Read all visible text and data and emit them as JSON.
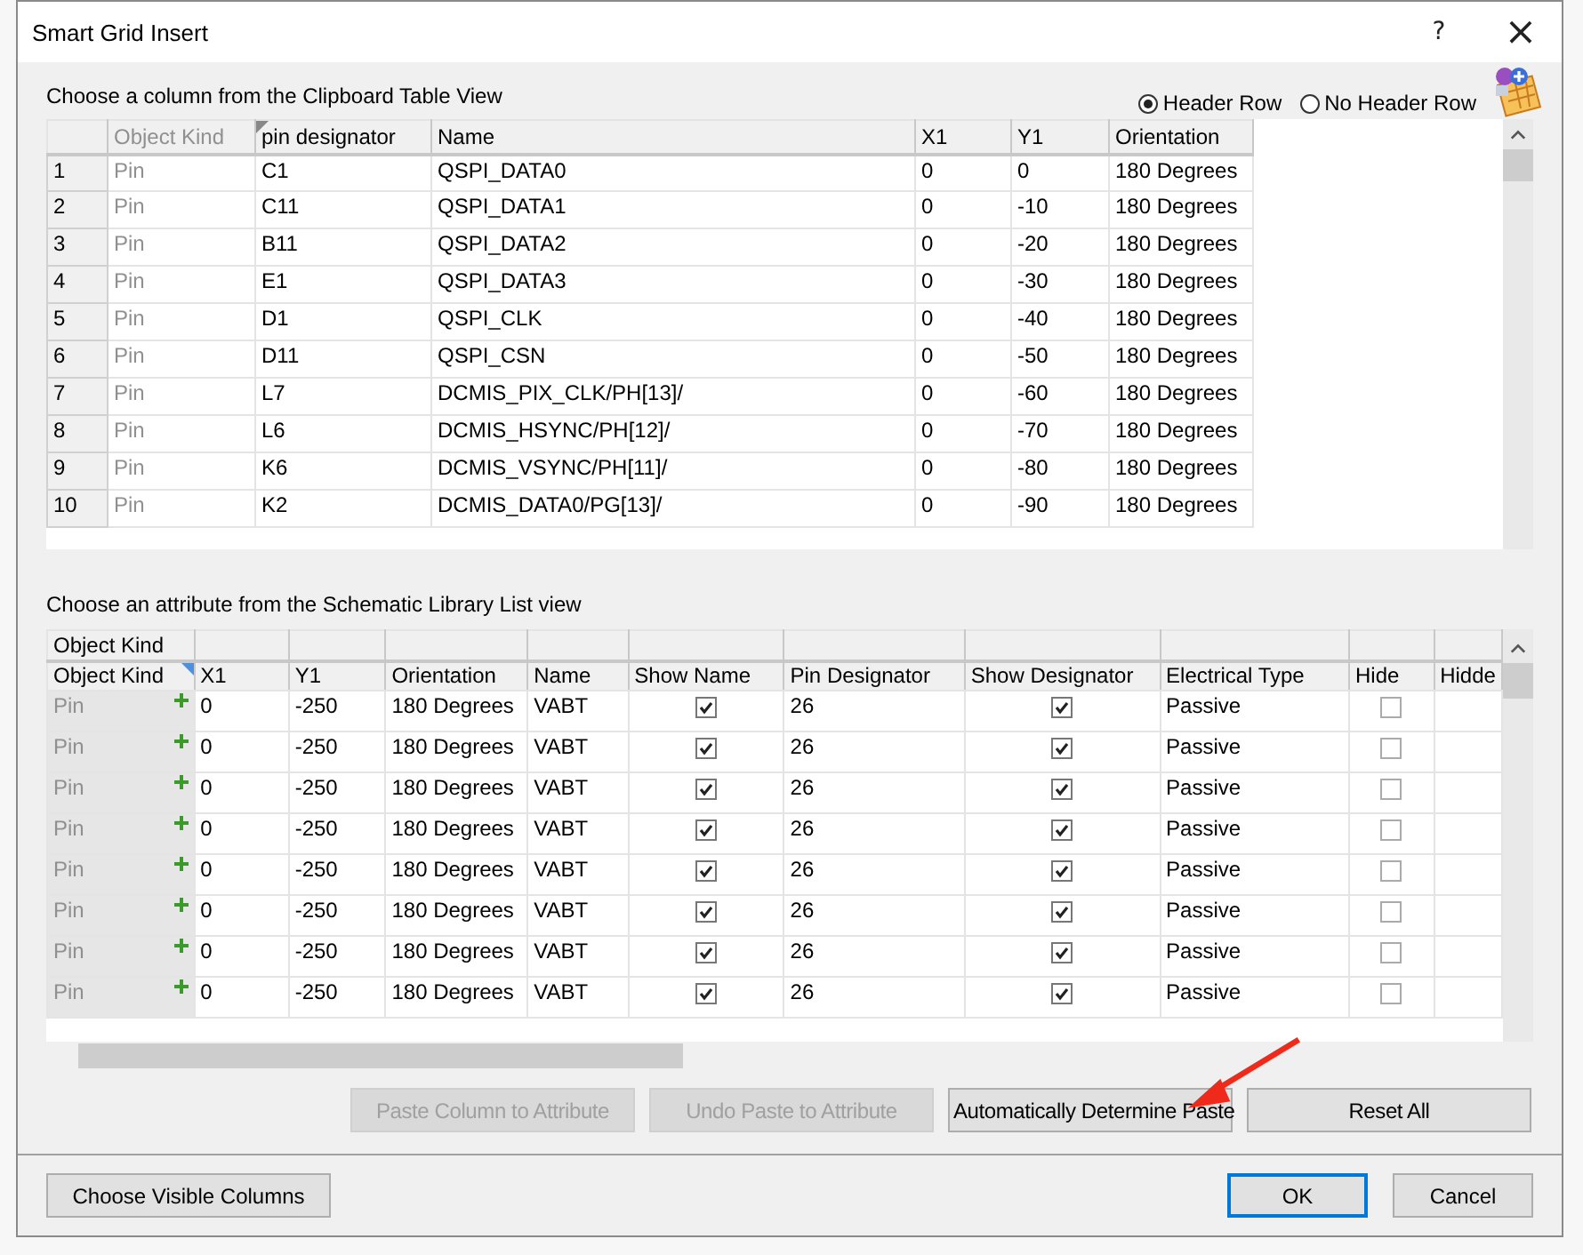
{
  "window": {
    "title": "Smart Grid Insert",
    "help": "?",
    "close": "×"
  },
  "clipboard": {
    "label": "Choose a column from the Clipboard Table View",
    "header_options": [
      {
        "label": "Header Row",
        "selected": true
      },
      {
        "label": "No Header Row",
        "selected": false
      }
    ],
    "columns": [
      "",
      "Object Kind",
      "pin designator",
      "Name",
      "X1",
      "Y1",
      "Orientation"
    ],
    "rows": [
      [
        "1",
        "Pin",
        "C1",
        "QSPI_DATA0",
        "0",
        "0",
        "180 Degrees"
      ],
      [
        "2",
        "Pin",
        "C11",
        "QSPI_DATA1",
        "0",
        "-10",
        "180 Degrees"
      ],
      [
        "3",
        "Pin",
        "B11",
        "QSPI_DATA2",
        "0",
        "-20",
        "180 Degrees"
      ],
      [
        "4",
        "Pin",
        "E1",
        "QSPI_DATA3",
        "0",
        "-30",
        "180 Degrees"
      ],
      [
        "5",
        "Pin",
        "D1",
        "QSPI_CLK",
        "0",
        "-40",
        "180 Degrees"
      ],
      [
        "6",
        "Pin",
        "D11",
        "QSPI_CSN",
        "0",
        "-50",
        "180 Degrees"
      ],
      [
        "7",
        "Pin",
        "L7",
        "DCMIS_PIX_CLK/PH[13]/",
        "0",
        "-60",
        "180 Degrees"
      ],
      [
        "8",
        "Pin",
        "L6",
        "DCMIS_HSYNC/PH[12]/",
        "0",
        "-70",
        "180 Degrees"
      ],
      [
        "9",
        "Pin",
        "K6",
        "DCMIS_VSYNC/PH[11]/",
        "0",
        "-80",
        "180 Degrees"
      ],
      [
        "10",
        "Pin",
        "K2",
        "DCMIS_DATA0/PG[13]/",
        "0",
        "-90",
        "180 Degrees"
      ]
    ]
  },
  "library": {
    "label": "Choose an attribute from the Schematic Library List view",
    "group_header": "Object Kind",
    "columns": [
      {
        "label": "Object Kind",
        "kind": "kind"
      },
      {
        "label": "X1",
        "kind": "text"
      },
      {
        "label": "Y1",
        "kind": "text"
      },
      {
        "label": "Orientation",
        "kind": "text"
      },
      {
        "label": "Name",
        "kind": "text"
      },
      {
        "label": "Show Name",
        "kind": "check"
      },
      {
        "label": "Pin Designator",
        "kind": "text"
      },
      {
        "label": "Show Designator",
        "kind": "check"
      },
      {
        "label": "Electrical Type",
        "kind": "text"
      },
      {
        "label": "Hide",
        "kind": "check"
      },
      {
        "label": "Hidde",
        "kind": "text"
      }
    ],
    "rows": [
      {
        "cells": [
          "Pin",
          "0",
          "-250",
          "180 Degrees",
          "VABT",
          true,
          "26",
          true,
          "Passive",
          false
        ]
      },
      {
        "cells": [
          "Pin",
          "0",
          "-250",
          "180 Degrees",
          "VABT",
          true,
          "26",
          true,
          "Passive",
          false
        ]
      },
      {
        "cells": [
          "Pin",
          "0",
          "-250",
          "180 Degrees",
          "VABT",
          true,
          "26",
          true,
          "Passive",
          false
        ]
      },
      {
        "cells": [
          "Pin",
          "0",
          "-250",
          "180 Degrees",
          "VABT",
          true,
          "26",
          true,
          "Passive",
          false
        ]
      },
      {
        "cells": [
          "Pin",
          "0",
          "-250",
          "180 Degrees",
          "VABT",
          true,
          "26",
          true,
          "Passive",
          false
        ]
      },
      {
        "cells": [
          "Pin",
          "0",
          "-250",
          "180 Degrees",
          "VABT",
          true,
          "26",
          true,
          "Passive",
          false
        ]
      },
      {
        "cells": [
          "Pin",
          "0",
          "-250",
          "180 Degrees",
          "VABT",
          true,
          "26",
          true,
          "Passive",
          false
        ]
      },
      {
        "cells": [
          "Pin",
          "0",
          "-250",
          "180 Degrees",
          "VABT",
          true,
          "26",
          true,
          "Passive",
          false
        ]
      }
    ]
  },
  "actions": [
    {
      "label": "Paste Column to Attribute",
      "disabled": true
    },
    {
      "label": "Undo Paste to Attribute",
      "disabled": true
    },
    {
      "label": "Automatically Determine Paste",
      "disabled": false
    },
    {
      "label": "Reset All",
      "disabled": false
    }
  ],
  "footer": {
    "left": "Choose Visible Columns",
    "buttons": [
      {
        "label": "OK",
        "focused": true
      },
      {
        "label": "Cancel",
        "focused": false
      }
    ]
  }
}
